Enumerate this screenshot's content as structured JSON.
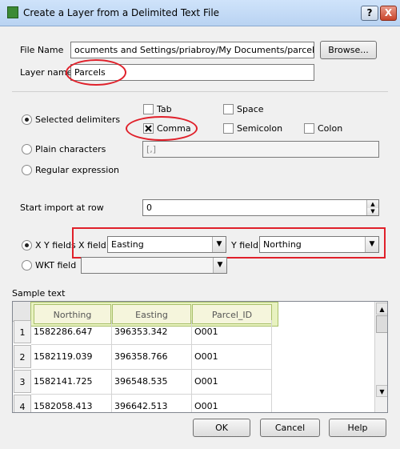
{
  "window": {
    "title": "Create a Layer from a Delimited Text File",
    "help_btn": "?",
    "close_btn": "X"
  },
  "file": {
    "label": "File Name",
    "value": "ocuments and Settings/priabroy/My Documents/parcels_id.csv",
    "browse": "Browse..."
  },
  "layer": {
    "label": "Layer name",
    "value": "Parcels"
  },
  "delimiters": {
    "selected_label": "Selected delimiters",
    "plain_label": "Plain characters",
    "plain_value": "[,]",
    "regex_label": "Regular expression",
    "options": {
      "tab": "Tab",
      "space": "Space",
      "comma": "Comma",
      "semicolon": "Semicolon",
      "colon": "Colon"
    }
  },
  "start_row": {
    "label": "Start import at row",
    "value": "0"
  },
  "xy": {
    "label": "X Y fields",
    "x_label": "X field",
    "x_value": "Easting",
    "y_label": "Y field",
    "y_value": "Northing"
  },
  "wkt": {
    "label": "WKT field",
    "value": ""
  },
  "sample": {
    "label": "Sample text",
    "columns": [
      "Northing",
      "Easting",
      "Parcel_ID"
    ],
    "rows": [
      {
        "num": "1",
        "cells": [
          "1582286.647",
          "396353.342",
          "O001"
        ]
      },
      {
        "num": "2",
        "cells": [
          "1582119.039",
          "396358.766",
          "O001"
        ]
      },
      {
        "num": "3",
        "cells": [
          "1582141.725",
          "396548.535",
          "O001"
        ]
      },
      {
        "num": "4",
        "cells": [
          "1582058.413",
          "396642.513",
          "O001"
        ]
      }
    ]
  },
  "buttons": {
    "ok": "OK",
    "cancel": "Cancel",
    "help": "Help"
  }
}
